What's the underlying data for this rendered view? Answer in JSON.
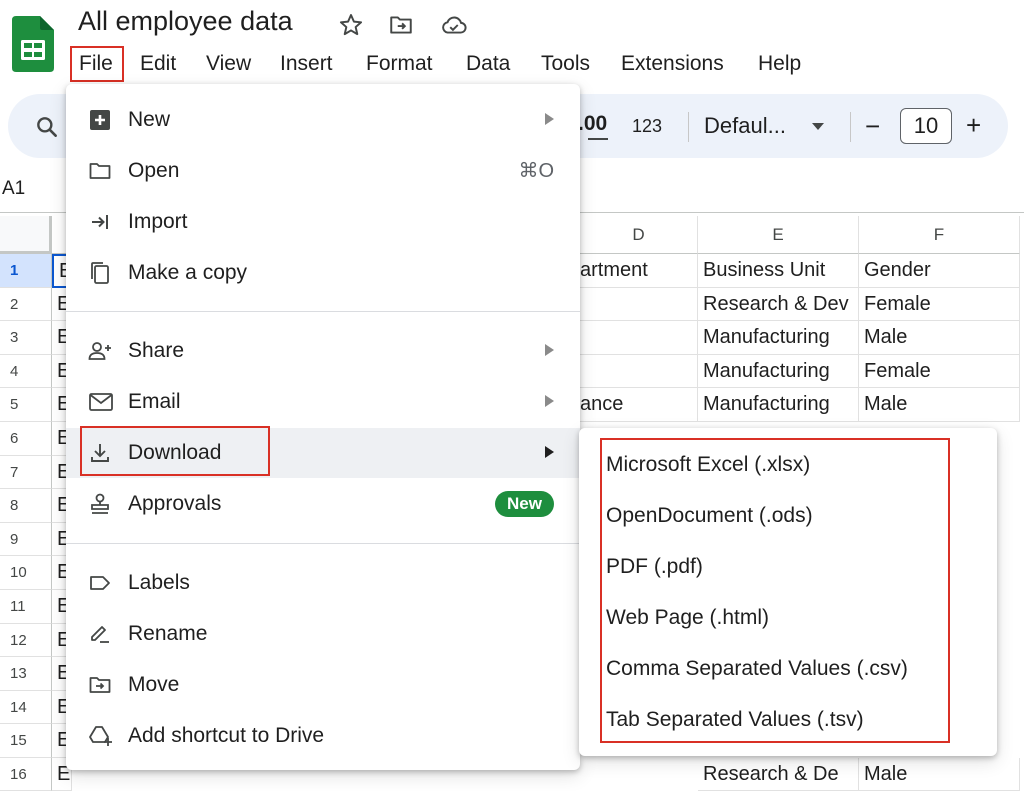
{
  "app": {
    "doc_title": "All employee data",
    "brand_color": "#1e8e3e",
    "highlight_color": "#d93025",
    "icons": [
      "sheets-logo-icon",
      "star-icon",
      "move-to-folder-icon",
      "cloud-saved-icon"
    ]
  },
  "menubar": {
    "items": [
      "File",
      "Edit",
      "View",
      "Insert",
      "Format",
      "Data",
      "Tools",
      "Extensions",
      "Help"
    ]
  },
  "toolbar": {
    "decimal_label": ".00",
    "number_format_label": "123",
    "font_label": "Defaul...",
    "font_size": "10",
    "minus_label": "−",
    "plus_label": "+"
  },
  "namebox": {
    "value": "A1"
  },
  "grid": {
    "columns": [
      "D",
      "E",
      "F"
    ],
    "row_numbers": [
      "1",
      "2",
      "3",
      "4",
      "5",
      "6",
      "7",
      "8",
      "9",
      "10",
      "11",
      "12",
      "13",
      "14",
      "15",
      "16"
    ],
    "col_a_chars": [
      "E",
      "E",
      "E",
      "E",
      "E",
      "E",
      "E",
      "E",
      "E",
      "E",
      "E",
      "E",
      "E",
      "E",
      "E",
      "E"
    ],
    "col_d": [
      "artment",
      "",
      "",
      "",
      "ance"
    ],
    "col_e": [
      "Business Unit",
      "Research & Dev",
      "Manufacturing",
      "Manufacturing",
      "Manufacturing",
      "",
      "",
      "",
      "",
      "",
      "",
      "",
      "",
      "",
      "",
      "Research & De"
    ],
    "col_f": [
      "Gender",
      "Female",
      "Male",
      "Female",
      "Male",
      "",
      "",
      "",
      "",
      "",
      "",
      "",
      "",
      "",
      "",
      "Male"
    ]
  },
  "file_menu": {
    "new": "New",
    "open": "Open",
    "open_shortcut": "⌘O",
    "import": "Import",
    "make_copy": "Make a copy",
    "share": "Share",
    "email": "Email",
    "download": "Download",
    "approvals": "Approvals",
    "approvals_badge": "New",
    "labels": "Labels",
    "rename": "Rename",
    "move": "Move",
    "add_shortcut": "Add shortcut to Drive"
  },
  "download_submenu": {
    "items": [
      "Microsoft Excel (.xlsx)",
      "OpenDocument (.ods)",
      "PDF (.pdf)",
      "Web Page (.html)",
      "Comma Separated Values (.csv)",
      "Tab Separated Values (.tsv)"
    ]
  }
}
